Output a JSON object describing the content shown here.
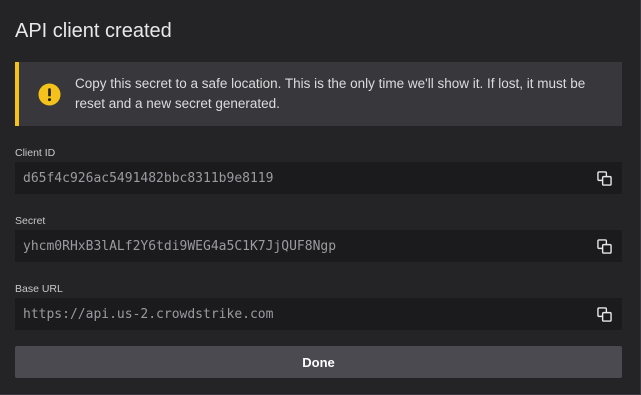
{
  "dialog": {
    "title": "API client created",
    "alert": {
      "icon": "warning-icon",
      "accent_color": "#f4c21b",
      "message": "Copy this secret to a safe location. This is the only time we'll show it. If lost, it must be reset and a new secret generated."
    },
    "fields": {
      "client_id": {
        "label": "Client ID",
        "value": "d65f4c926ac5491482bbc8311b9e8119",
        "copy_icon": "copy-icon"
      },
      "secret": {
        "label": "Secret",
        "value": "yhcm0RHxB3lALf2Y6tdi9WEG4a5C1K7JjQUF8Ngp",
        "copy_icon": "copy-icon"
      },
      "base_url": {
        "label": "Base URL",
        "value": "https://api.us-2.crowdstrike.com",
        "copy_icon": "copy-icon"
      }
    },
    "done_label": "Done"
  }
}
